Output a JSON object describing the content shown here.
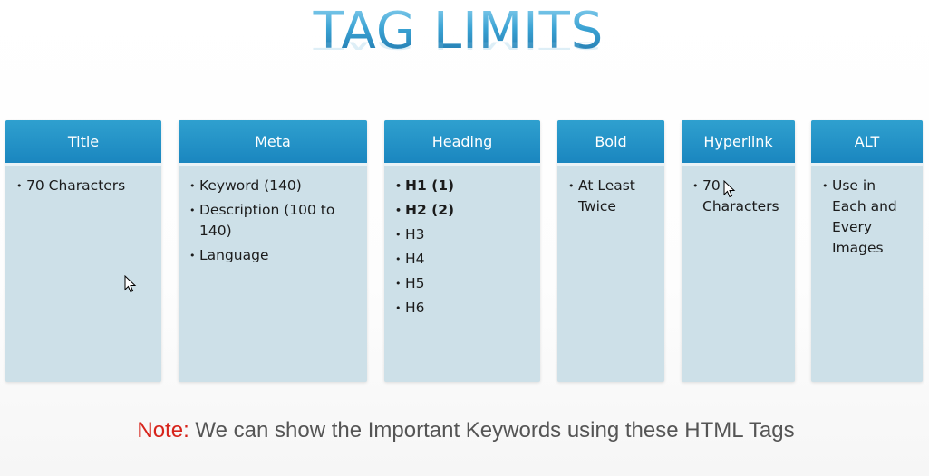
{
  "slide": {
    "title": "TAG LIMITS",
    "cards": [
      {
        "header": "Title",
        "items": [
          "70 Characters"
        ]
      },
      {
        "header": "Meta",
        "items": [
          "Keyword (140)",
          "Description (100 to 140)",
          "Language"
        ]
      },
      {
        "header": "Heading",
        "items": [
          "H1 (1)",
          "H2 (2)",
          "H3",
          "H4",
          "H5",
          "H6"
        ]
      },
      {
        "header": "Bold",
        "items": [
          "At Least Twice"
        ]
      },
      {
        "header": "Hyperlink",
        "items": [
          "70 Characters"
        ]
      },
      {
        "header": "ALT",
        "items": [
          "Use in Each and Every Images"
        ]
      }
    ],
    "note": {
      "label": "Note:",
      "text": " We can show the Important Keywords using these HTML Tags"
    }
  },
  "colors": {
    "header_bg": "#1a86bf",
    "card_bg": "#cde0e8",
    "title": "#2b8fc3",
    "note_label": "#d7241b",
    "note_text": "#555555"
  }
}
